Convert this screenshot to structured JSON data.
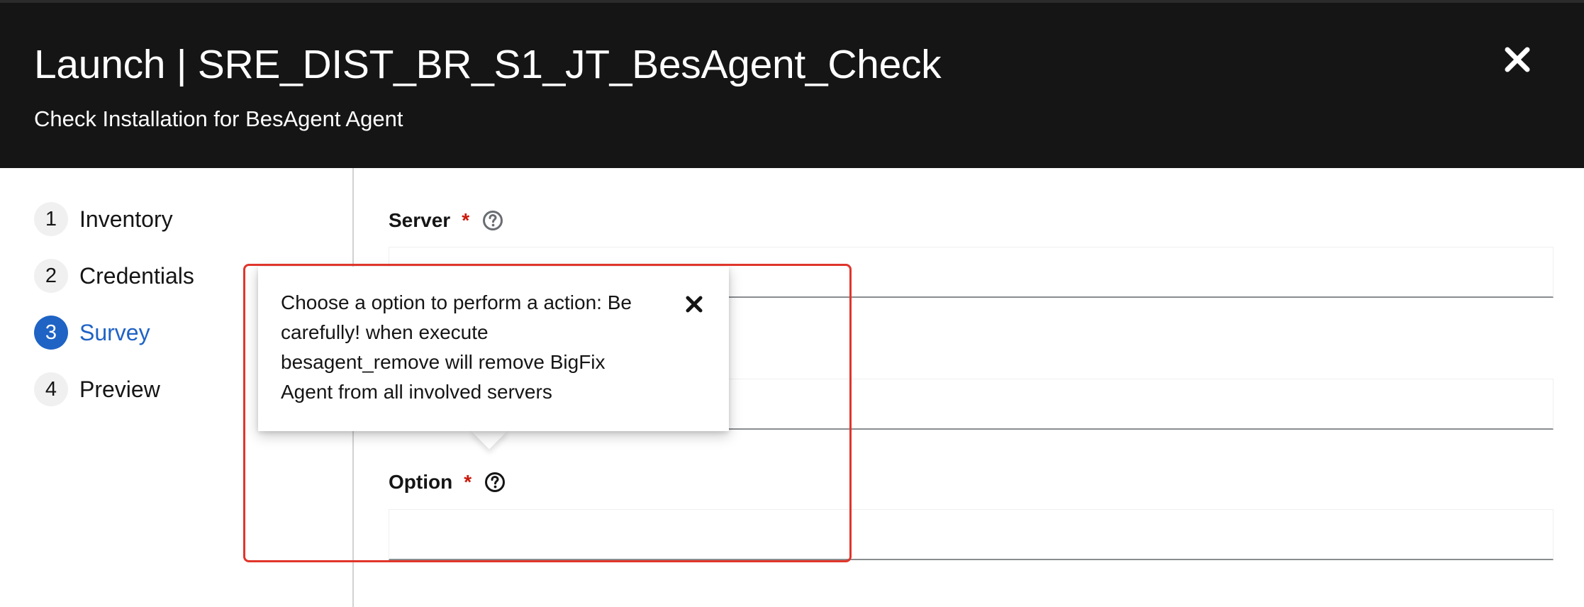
{
  "header": {
    "title": "Launch | SRE_DIST_BR_S1_JT_BesAgent_Check",
    "description": "Check Installation for BesAgent Agent",
    "close_icon": "close-icon"
  },
  "wizard_nav": {
    "steps": [
      {
        "number": "1",
        "label": "Inventory"
      },
      {
        "number": "2",
        "label": "Credentials"
      },
      {
        "number": "3",
        "label": "Survey",
        "current": true
      },
      {
        "number": "4",
        "label": "Preview"
      }
    ]
  },
  "form": {
    "server": {
      "label": "Server",
      "required_mark": "*",
      "value": ""
    },
    "field2": {
      "value": ""
    },
    "option": {
      "label": "Option",
      "required_mark": "*",
      "value": ""
    }
  },
  "popover": {
    "lines": [
      "Choose a option to perform a action: Be",
      "carefully! when execute",
      "besagent_remove will remove BigFix",
      "Agent from all involved servers"
    ],
    "close_icon": "close-icon"
  },
  "colors": {
    "header_bg": "#151515",
    "accent": "#1f63c5",
    "required": "#c9190b",
    "highlight": "#e0352b"
  }
}
